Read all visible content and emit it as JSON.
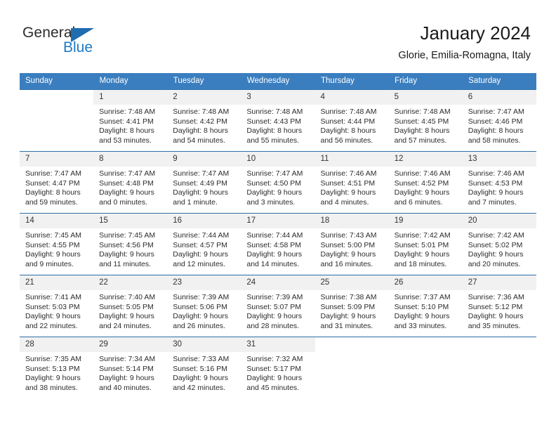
{
  "brand": {
    "name_dark": "General",
    "name_blue": "Blue",
    "accent_color": "#1f7ac4",
    "triangle_color": "#1f6cb0"
  },
  "header": {
    "title": "January 2024",
    "subtitle": "Glorie, Emilia-Romagna, Italy",
    "header_bg": "#3a7ebf",
    "header_text_color": "#ffffff",
    "daynum_bg": "#f1f1f1"
  },
  "weekdays": [
    "Sunday",
    "Monday",
    "Tuesday",
    "Wednesday",
    "Thursday",
    "Friday",
    "Saturday"
  ],
  "weeks": [
    [
      {
        "day": "",
        "sunrise": "",
        "sunset": "",
        "daylight_line1": "",
        "daylight_line2": ""
      },
      {
        "day": "1",
        "sunrise": "Sunrise: 7:48 AM",
        "sunset": "Sunset: 4:41 PM",
        "daylight_line1": "Daylight: 8 hours",
        "daylight_line2": "and 53 minutes."
      },
      {
        "day": "2",
        "sunrise": "Sunrise: 7:48 AM",
        "sunset": "Sunset: 4:42 PM",
        "daylight_line1": "Daylight: 8 hours",
        "daylight_line2": "and 54 minutes."
      },
      {
        "day": "3",
        "sunrise": "Sunrise: 7:48 AM",
        "sunset": "Sunset: 4:43 PM",
        "daylight_line1": "Daylight: 8 hours",
        "daylight_line2": "and 55 minutes."
      },
      {
        "day": "4",
        "sunrise": "Sunrise: 7:48 AM",
        "sunset": "Sunset: 4:44 PM",
        "daylight_line1": "Daylight: 8 hours",
        "daylight_line2": "and 56 minutes."
      },
      {
        "day": "5",
        "sunrise": "Sunrise: 7:48 AM",
        "sunset": "Sunset: 4:45 PM",
        "daylight_line1": "Daylight: 8 hours",
        "daylight_line2": "and 57 minutes."
      },
      {
        "day": "6",
        "sunrise": "Sunrise: 7:47 AM",
        "sunset": "Sunset: 4:46 PM",
        "daylight_line1": "Daylight: 8 hours",
        "daylight_line2": "and 58 minutes."
      }
    ],
    [
      {
        "day": "7",
        "sunrise": "Sunrise: 7:47 AM",
        "sunset": "Sunset: 4:47 PM",
        "daylight_line1": "Daylight: 8 hours",
        "daylight_line2": "and 59 minutes."
      },
      {
        "day": "8",
        "sunrise": "Sunrise: 7:47 AM",
        "sunset": "Sunset: 4:48 PM",
        "daylight_line1": "Daylight: 9 hours",
        "daylight_line2": "and 0 minutes."
      },
      {
        "day": "9",
        "sunrise": "Sunrise: 7:47 AM",
        "sunset": "Sunset: 4:49 PM",
        "daylight_line1": "Daylight: 9 hours",
        "daylight_line2": "and 1 minute."
      },
      {
        "day": "10",
        "sunrise": "Sunrise: 7:47 AM",
        "sunset": "Sunset: 4:50 PM",
        "daylight_line1": "Daylight: 9 hours",
        "daylight_line2": "and 3 minutes."
      },
      {
        "day": "11",
        "sunrise": "Sunrise: 7:46 AM",
        "sunset": "Sunset: 4:51 PM",
        "daylight_line1": "Daylight: 9 hours",
        "daylight_line2": "and 4 minutes."
      },
      {
        "day": "12",
        "sunrise": "Sunrise: 7:46 AM",
        "sunset": "Sunset: 4:52 PM",
        "daylight_line1": "Daylight: 9 hours",
        "daylight_line2": "and 6 minutes."
      },
      {
        "day": "13",
        "sunrise": "Sunrise: 7:46 AM",
        "sunset": "Sunset: 4:53 PM",
        "daylight_line1": "Daylight: 9 hours",
        "daylight_line2": "and 7 minutes."
      }
    ],
    [
      {
        "day": "14",
        "sunrise": "Sunrise: 7:45 AM",
        "sunset": "Sunset: 4:55 PM",
        "daylight_line1": "Daylight: 9 hours",
        "daylight_line2": "and 9 minutes."
      },
      {
        "day": "15",
        "sunrise": "Sunrise: 7:45 AM",
        "sunset": "Sunset: 4:56 PM",
        "daylight_line1": "Daylight: 9 hours",
        "daylight_line2": "and 11 minutes."
      },
      {
        "day": "16",
        "sunrise": "Sunrise: 7:44 AM",
        "sunset": "Sunset: 4:57 PM",
        "daylight_line1": "Daylight: 9 hours",
        "daylight_line2": "and 12 minutes."
      },
      {
        "day": "17",
        "sunrise": "Sunrise: 7:44 AM",
        "sunset": "Sunset: 4:58 PM",
        "daylight_line1": "Daylight: 9 hours",
        "daylight_line2": "and 14 minutes."
      },
      {
        "day": "18",
        "sunrise": "Sunrise: 7:43 AM",
        "sunset": "Sunset: 5:00 PM",
        "daylight_line1": "Daylight: 9 hours",
        "daylight_line2": "and 16 minutes."
      },
      {
        "day": "19",
        "sunrise": "Sunrise: 7:42 AM",
        "sunset": "Sunset: 5:01 PM",
        "daylight_line1": "Daylight: 9 hours",
        "daylight_line2": "and 18 minutes."
      },
      {
        "day": "20",
        "sunrise": "Sunrise: 7:42 AM",
        "sunset": "Sunset: 5:02 PM",
        "daylight_line1": "Daylight: 9 hours",
        "daylight_line2": "and 20 minutes."
      }
    ],
    [
      {
        "day": "21",
        "sunrise": "Sunrise: 7:41 AM",
        "sunset": "Sunset: 5:03 PM",
        "daylight_line1": "Daylight: 9 hours",
        "daylight_line2": "and 22 minutes."
      },
      {
        "day": "22",
        "sunrise": "Sunrise: 7:40 AM",
        "sunset": "Sunset: 5:05 PM",
        "daylight_line1": "Daylight: 9 hours",
        "daylight_line2": "and 24 minutes."
      },
      {
        "day": "23",
        "sunrise": "Sunrise: 7:39 AM",
        "sunset": "Sunset: 5:06 PM",
        "daylight_line1": "Daylight: 9 hours",
        "daylight_line2": "and 26 minutes."
      },
      {
        "day": "24",
        "sunrise": "Sunrise: 7:39 AM",
        "sunset": "Sunset: 5:07 PM",
        "daylight_line1": "Daylight: 9 hours",
        "daylight_line2": "and 28 minutes."
      },
      {
        "day": "25",
        "sunrise": "Sunrise: 7:38 AM",
        "sunset": "Sunset: 5:09 PM",
        "daylight_line1": "Daylight: 9 hours",
        "daylight_line2": "and 31 minutes."
      },
      {
        "day": "26",
        "sunrise": "Sunrise: 7:37 AM",
        "sunset": "Sunset: 5:10 PM",
        "daylight_line1": "Daylight: 9 hours",
        "daylight_line2": "and 33 minutes."
      },
      {
        "day": "27",
        "sunrise": "Sunrise: 7:36 AM",
        "sunset": "Sunset: 5:12 PM",
        "daylight_line1": "Daylight: 9 hours",
        "daylight_line2": "and 35 minutes."
      }
    ],
    [
      {
        "day": "28",
        "sunrise": "Sunrise: 7:35 AM",
        "sunset": "Sunset: 5:13 PM",
        "daylight_line1": "Daylight: 9 hours",
        "daylight_line2": "and 38 minutes."
      },
      {
        "day": "29",
        "sunrise": "Sunrise: 7:34 AM",
        "sunset": "Sunset: 5:14 PM",
        "daylight_line1": "Daylight: 9 hours",
        "daylight_line2": "and 40 minutes."
      },
      {
        "day": "30",
        "sunrise": "Sunrise: 7:33 AM",
        "sunset": "Sunset: 5:16 PM",
        "daylight_line1": "Daylight: 9 hours",
        "daylight_line2": "and 42 minutes."
      },
      {
        "day": "31",
        "sunrise": "Sunrise: 7:32 AM",
        "sunset": "Sunset: 5:17 PM",
        "daylight_line1": "Daylight: 9 hours",
        "daylight_line2": "and 45 minutes."
      },
      {
        "day": "",
        "sunrise": "",
        "sunset": "",
        "daylight_line1": "",
        "daylight_line2": ""
      },
      {
        "day": "",
        "sunrise": "",
        "sunset": "",
        "daylight_line1": "",
        "daylight_line2": ""
      },
      {
        "day": "",
        "sunrise": "",
        "sunset": "",
        "daylight_line1": "",
        "daylight_line2": ""
      }
    ]
  ]
}
